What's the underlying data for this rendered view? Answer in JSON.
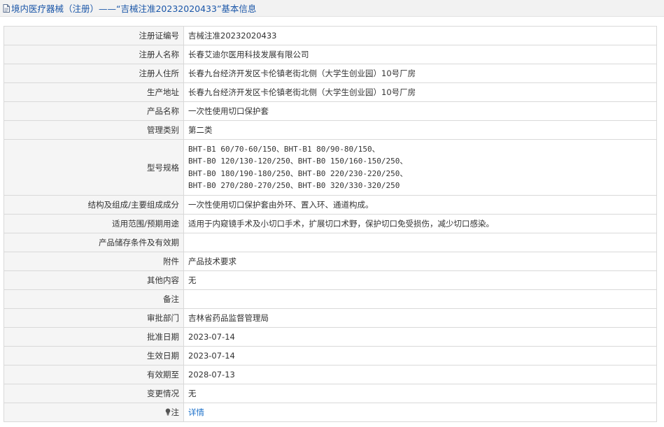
{
  "header": {
    "title": "境内医疗器械（注册）——“吉械注准20232020433”基本信息",
    "icon": "document-icon"
  },
  "rows": [
    {
      "label": "注册证编号",
      "value": "吉械注准20232020433"
    },
    {
      "label": "注册人名称",
      "value": "长春艾迪尔医用科技发展有限公司"
    },
    {
      "label": "注册人住所",
      "value": "长春九台经济开发区卡伦镇老街北侧（大学生创业园）10号厂房"
    },
    {
      "label": "生产地址",
      "value": "长春九台经济开发区卡伦镇老街北侧（大学生创业园）10号厂房"
    },
    {
      "label": "产品名称",
      "value": "一次性使用切口保护套"
    },
    {
      "label": "管理类别",
      "value": "第二类"
    }
  ],
  "model_spec": {
    "label": "型号规格",
    "lines": [
      "BHT-B1 60/70-60/150、BHT-B1 80/90-80/150、",
      "BHT-B0 120/130-120/250、BHT-B0 150/160-150/250、",
      "BHT-B0 180/190-180/250、BHT-B0 220/230-220/250、",
      "BHT-B0 270/280-270/250、BHT-B0 320/330-320/250"
    ]
  },
  "rows2": [
    {
      "label": "结构及组成/主要组成成分",
      "value": "一次性使用切口保护套由外环、置入环、通道构成。"
    },
    {
      "label": "适用范围/预期用途",
      "value": "适用于内窥镜手术及小切口手术，扩展切口术野，保护切口免受损伤，减少切口感染。"
    },
    {
      "label": "产品储存条件及有效期",
      "value": ""
    },
    {
      "label": "附件",
      "value": "产品技术要求"
    },
    {
      "label": "其他内容",
      "value": "无"
    },
    {
      "label": "备注",
      "value": ""
    },
    {
      "label": "审批部门",
      "value": "吉林省药品监督管理局"
    },
    {
      "label": "批准日期",
      "value": "2023-07-14"
    },
    {
      "label": "生效日期",
      "value": "2023-07-14"
    },
    {
      "label": "有效期至",
      "value": "2028-07-13"
    },
    {
      "label": "变更情况",
      "value": "无"
    }
  ],
  "note": {
    "label": "注",
    "icon": "lightbulb-icon",
    "link_text": "详情"
  },
  "colors": {
    "title": "#1a56a8",
    "link": "#1a6fc9",
    "label_bg": "#f5f5f5",
    "border": "#d9d9d9"
  }
}
